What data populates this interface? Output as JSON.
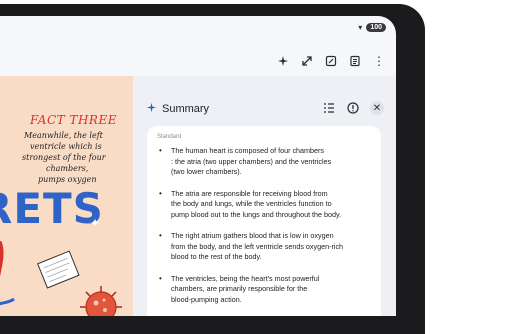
{
  "status_bar": {
    "signal_icon": "signal-wifi-icon",
    "battery": "100"
  },
  "toolbar": {
    "icons": [
      "ai-sparkle-icon",
      "expand-icon",
      "edit-icon",
      "notes-icon",
      "more-vert-icon"
    ]
  },
  "note": {
    "fact_title": "FACT THREE",
    "lines": [
      "Meanwhile, the left",
      "ventricle which is",
      "strongest of the four",
      "chambers,",
      "pumps oxygen"
    ],
    "big_word": "RETS"
  },
  "summary": {
    "title": "Summary",
    "style_label": "Standard",
    "bullets": [
      "The human heart is composed of four chambers\n: the atria (two upper chambers) and the ventricles\n(two lower chambers).",
      "The atria are responsible for receiving blood from\nthe body and lungs, while the ventricles function to\npump blood out to the lungs and throughout the body.",
      "The right atrium gathers blood that is low in oxygen\nfrom the body, and the left ventricle sends oxygen-rich\nblood to the rest of the body.",
      "The ventricles, being the heart's most powerful\nchambers, are primarily responsible for the\nblood-pumping action."
    ]
  },
  "colors": {
    "accent": "#2a5bd7",
    "note_bg": "#f9dcc6",
    "note_red": "#d9302a",
    "note_blue": "#2f63c8"
  }
}
